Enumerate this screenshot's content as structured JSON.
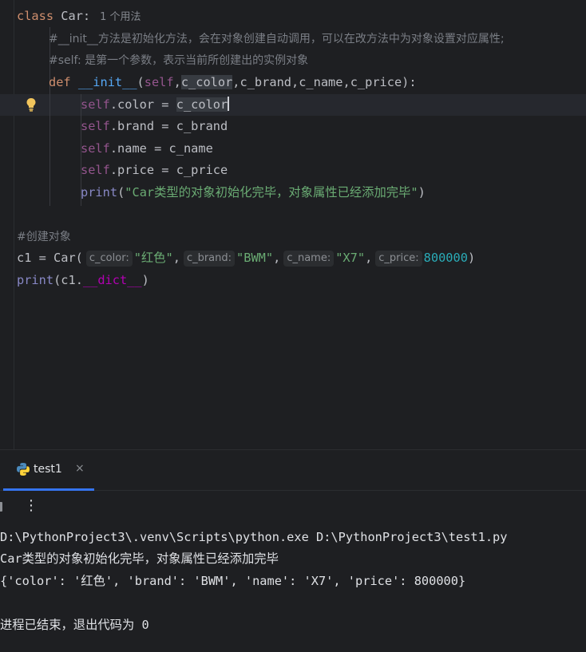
{
  "editor": {
    "line1": {
      "kw": "class",
      "name": "Car:",
      "usage": "1 个用法"
    },
    "line2": {
      "comment": "#__init__方法是初始化方法，会在对象创建自动调用，可以在改方法中为对象设置对应属性;"
    },
    "line3": {
      "comment": "#self: 是第一个参数，表示当前所创建出的实例对象"
    },
    "line4": {
      "kw": "def",
      "fn": "__init__",
      "open": "(",
      "self": "self",
      "comma1": ",",
      "p1": "c_color",
      "comma2": ",",
      "p2": "c_brand",
      "comma3": ",",
      "p3": "c_name",
      "comma4": ",",
      "p4": "c_price",
      "close": "):"
    },
    "line5": {
      "self": "self",
      "attr": ".color = ",
      "pre": "c_color"
    },
    "line6": {
      "self": "self",
      "attr": ".brand = c_brand"
    },
    "line7": {
      "self": "self",
      "attr": ".name = c_name"
    },
    "line8": {
      "self": "self",
      "attr": ".price = c_price"
    },
    "line9": {
      "fn": "print",
      "open": "(",
      "str": "\"Car类型的对象初始化完毕，对象属性已经添加完毕\"",
      "close": ")"
    },
    "line11": {
      "comment": "#创建对象"
    },
    "line12": {
      "lhs": "c1 = Car(",
      "h1": "c_color:",
      "v1": "\"红色\"",
      "c1": ",",
      "h2": "c_brand:",
      "v2": "\"BWM\"",
      "c2": ",",
      "h3": "c_name:",
      "v3": "\"X7\"",
      "c3": ",",
      "h4": "c_price:",
      "v4": "800000",
      "close": ")"
    },
    "line13": {
      "fn": "print",
      "open": "(c1.",
      "magic": "__dict__",
      "close": ")"
    }
  },
  "run": {
    "tab_label": "test1",
    "tab_close": "×",
    "more_icon": "⋮",
    "output": [
      "D:\\PythonProject3\\.venv\\Scripts\\python.exe D:\\PythonProject3\\test1.py",
      "Car类型的对象初始化完毕，对象属性已经添加完毕",
      "{'color': '红色', 'brand': 'BWM', 'name': 'X7', 'price': 800000}",
      "",
      "进程已结束，退出代码为 0"
    ]
  },
  "colors": {
    "background": "#1e1f22",
    "keyword": "#cf8e6d",
    "comment": "#7a7e85",
    "self": "#94558d",
    "function": "#56a8f5",
    "string": "#6aab73",
    "number": "#2aacb8",
    "accent": "#3574f0"
  }
}
